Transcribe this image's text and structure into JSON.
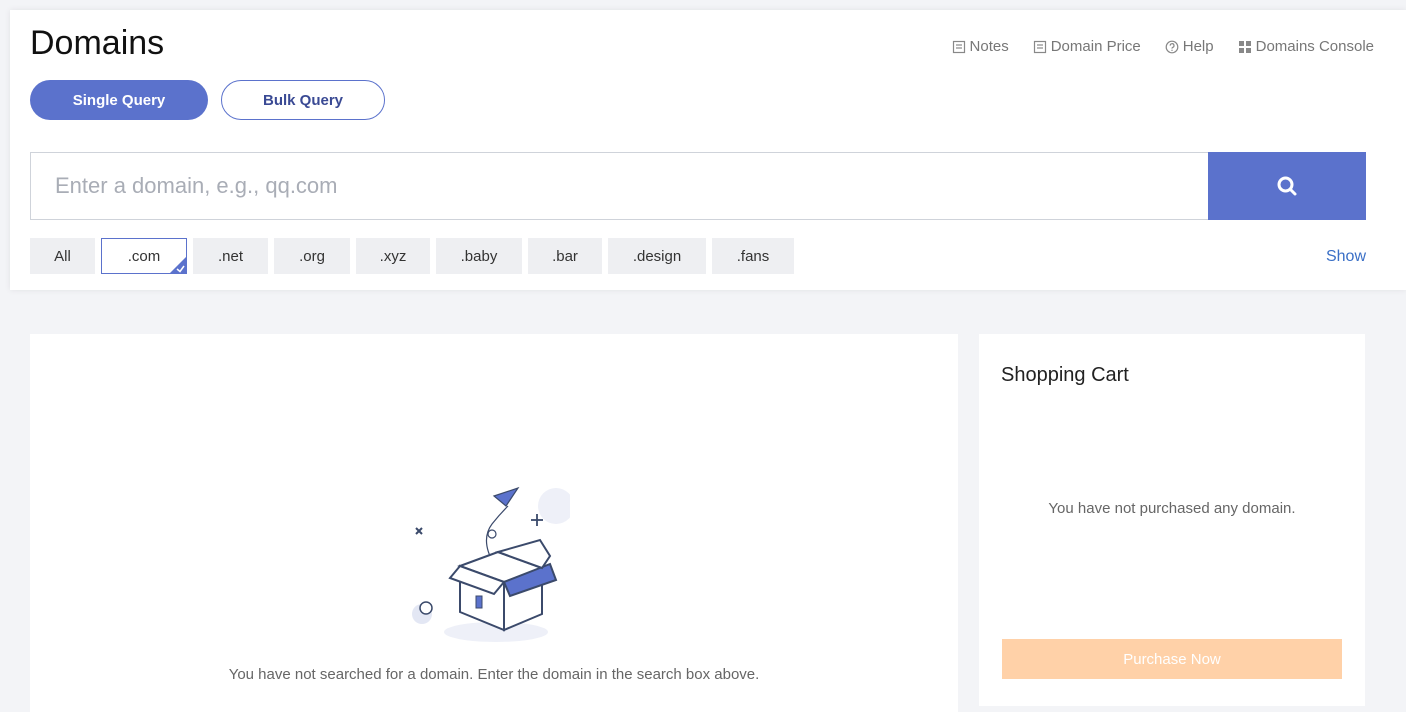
{
  "header": {
    "title": "Domains",
    "links": [
      {
        "label": "Notes",
        "icon": "document-icon"
      },
      {
        "label": "Domain Price",
        "icon": "document-icon"
      },
      {
        "label": "Help",
        "icon": "help-circle-icon"
      },
      {
        "label": "Domains Console",
        "icon": "grid-icon"
      }
    ]
  },
  "query_tabs": {
    "single_label": "Single Query",
    "bulk_label": "Bulk Query",
    "active": "single"
  },
  "search": {
    "placeholder": "Enter a domain, e.g., qq.com",
    "value": "",
    "button_icon": "search-icon"
  },
  "tlds": {
    "items": [
      "All",
      ".com",
      ".net",
      ".org",
      ".xyz",
      ".baby",
      ".bar",
      ".design",
      ".fans"
    ],
    "selected": ".com",
    "show_label": "Show"
  },
  "results": {
    "empty_message": "You have not searched for a domain. Enter the domain in the search box above."
  },
  "cart": {
    "title": "Shopping Cart",
    "empty_message": "You have not purchased any domain.",
    "purchase_label": "Purchase Now"
  },
  "colors": {
    "accent": "#5b72cc",
    "link": "#3a6fc6",
    "purchase_disabled": "#ffd1a8"
  }
}
